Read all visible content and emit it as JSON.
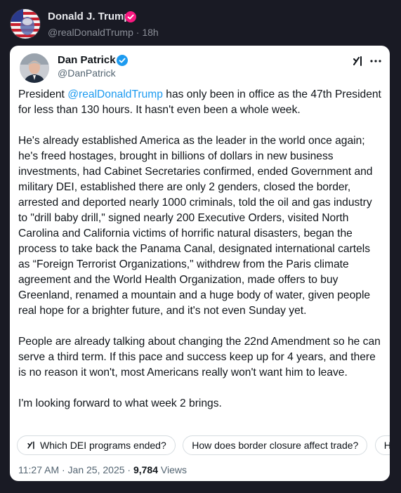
{
  "outer": {
    "name": "Donald J. Trump",
    "handle": "@realDonaldTrump",
    "separator": "·",
    "time": "18h",
    "badge_color": "#f91880"
  },
  "quoted": {
    "name": "Dan Patrick",
    "handle": "@DanPatrick",
    "badge_color": "#1d9bf0",
    "mention_color": "#1d9bf0",
    "p1_before": "President ",
    "p1_mention": "@realDonaldTrump",
    "p1_after": " has only been in office as the 47th President for less than 130 hours. It hasn't even been a whole week.",
    "p2": "He's already established America as the leader in the world once again; he's freed hostages, brought in billions of dollars in new business investments, had Cabinet Secretaries confirmed, ended Government and military DEI, established there are only 2 genders, closed the border, arrested and deported nearly 1000 criminals, told the oil and gas industry to \"drill baby drill,\" signed nearly 200 Executive Orders, visited North Carolina and California victims of horrific natural disasters, began the process to take back the Panama Canal, designated international cartels as “Foreign Terrorist Organizations,\" withdrew from the Paris climate agreement and the World Health Organization, made offers to buy Greenland, renamed a mountain and a huge body of water, given people real hope for a brighter future, and it's not even Sunday yet.",
    "p3": "People are already talking about changing the 22nd Amendment so he can serve a third term. If this pace and success keep up for 4 years, and there is no reason it won't, most Americans really won't want him to leave.",
    "p4": "I'm looking forward to what week 2 brings.",
    "chips": [
      "Which DEI programs ended?",
      "How does border closure affect trade?",
      "H"
    ],
    "time": "11:27 AM · Jan 25, 2025 ·",
    "views_count": "9,784",
    "views_label": "Views"
  },
  "icons": {
    "more": "more-icon",
    "grok": "grok-icon",
    "verified": "verified-badge-icon"
  }
}
